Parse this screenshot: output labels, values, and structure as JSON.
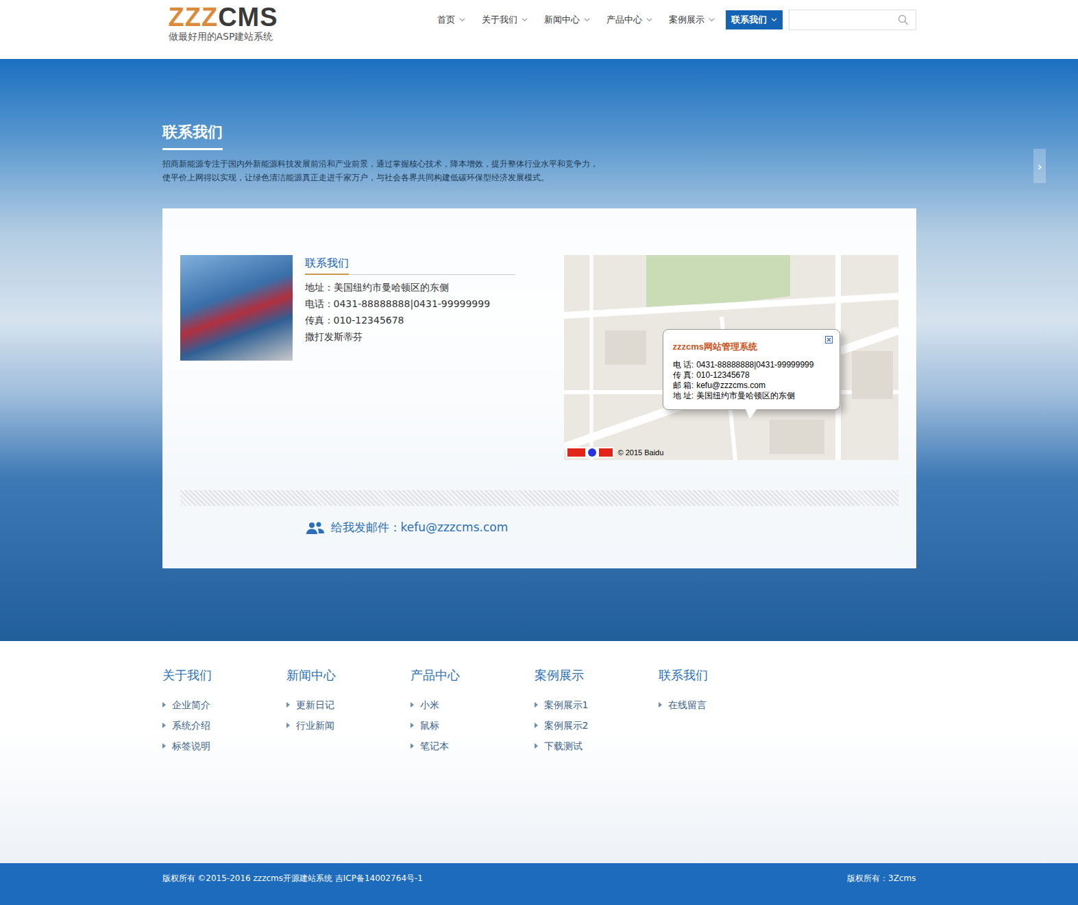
{
  "logo": {
    "brand_accent": "ZZZ",
    "brand_rest": "CMS",
    "tagline": "做最好用的ASP建站系统"
  },
  "nav": [
    {
      "label": "首页",
      "selected": false
    },
    {
      "label": "关于我们",
      "selected": false
    },
    {
      "label": "新闻中心",
      "selected": false
    },
    {
      "label": "产品中心",
      "selected": false
    },
    {
      "label": "案例展示",
      "selected": false
    },
    {
      "label": "联系我们",
      "selected": true
    }
  ],
  "search": {
    "placeholder": ""
  },
  "banner": {
    "title": "联系我们",
    "description": [
      "招商新能源专注于国内外新能源科技发展前沿和产业前景，通过掌握核心技术，降本增效，提升整体行业水平和竞争力，",
      "使平价上网得以实现，让绿色清洁能源真正走进千家万户，与社会各界共同构建低碳环保型经济发展模式。"
    ],
    "next_arrow": "›"
  },
  "contact": {
    "title": "联系我们",
    "lines": [
      "地址：美国纽约市曼哈顿区的东侧",
      "电话：0431-88888888|0431-99999999",
      "传真：010-12345678",
      "撒打发斯蒂芬"
    ]
  },
  "map": {
    "popup_title": "zzzcms网站管理系统",
    "popup_rows": [
      {
        "label": "电 话:",
        "value": "0431-88888888|0431-99999999"
      },
      {
        "label": "传 真:",
        "value": "010-12345678"
      },
      {
        "label": "邮 箱:",
        "value": "kefu@zzzcms.com"
      },
      {
        "label": "地 址:",
        "value": "美国纽约市曼哈顿区的东侧"
      }
    ],
    "credit": "© 2015 Baidu"
  },
  "email": "给我发邮件：kefu@zzzcms.com",
  "footer": [
    {
      "title": "关于我们",
      "links": [
        "企业简介",
        "系统介绍",
        "标签说明"
      ]
    },
    {
      "title": "新闻中心",
      "links": [
        "更新日记",
        "行业新闻"
      ]
    },
    {
      "title": "产品中心",
      "links": [
        "小米",
        "鼠标",
        "笔记本"
      ]
    },
    {
      "title": "案例展示",
      "links": [
        "案例展示1",
        "案例展示2",
        "下载测试"
      ]
    },
    {
      "title": "联系我们",
      "links": [
        "在线留言"
      ]
    }
  ],
  "copyright": {
    "left": "版权所有 ©2015-2016 zzzcms开源建站系统 吉ICP备14002764号-1",
    "right": "版权所有：3Zcms"
  }
}
